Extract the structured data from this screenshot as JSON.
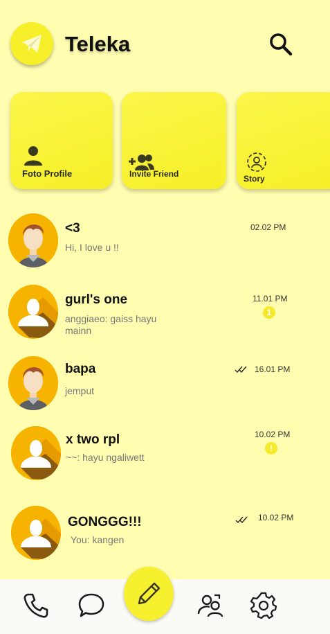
{
  "app": {
    "title": "Teleka"
  },
  "icons": {
    "logo": "telegram-paper-plane-icon",
    "search": "search-icon",
    "phone": "phone-icon",
    "chat": "chat-bubble-icon",
    "compose": "pencil-icon",
    "contacts": "contacts-icon",
    "settings": "gear-icon"
  },
  "actions": [
    {
      "label": "Foto Profile",
      "icon": "user-icon"
    },
    {
      "label": "Invite Friend",
      "icon": "add-friend-icon"
    },
    {
      "label": "Story",
      "icon": "story-icon"
    }
  ],
  "chats": [
    {
      "name": "<3",
      "message": "Hi, I love u !!",
      "time": "02.02 PM",
      "avatar": "man-avatar",
      "status": ""
    },
    {
      "name": "gurl's one",
      "message": "anggiaeo: gaiss hayu mainn",
      "time": "11.01 PM",
      "avatar": "default-avatar",
      "badge": "1"
    },
    {
      "name": "bapa",
      "message": "jemput",
      "time": "16.01 PM",
      "avatar": "man-avatar",
      "status": "read"
    },
    {
      "name": "x two rpl",
      "message": "~~: hayu ngaliwett",
      "time": "10.02 PM",
      "avatar": "default-avatar",
      "badge": "!"
    },
    {
      "name": "GONGGG!!!",
      "message": "You: kangen",
      "time": "10.02 PM",
      "avatar": "default-avatar",
      "status": "read"
    }
  ],
  "colors": {
    "background": "#fffdb0",
    "accent": "#f7ef2a",
    "avatar_bg": "#f6b400"
  }
}
